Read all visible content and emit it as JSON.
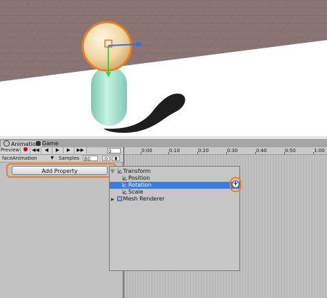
{
  "tabs": [
    {
      "label": "Animation",
      "icon": "animation-clock-icon",
      "active": true
    },
    {
      "label": "Game",
      "icon": "game-controller-icon",
      "active": false
    }
  ],
  "toolbar": {
    "preview_label": "Preview",
    "record_icon": "record-dot-icon",
    "nav_icons": [
      "first-keyframe-icon",
      "prev-keyframe-icon",
      "play-icon",
      "next-keyframe-icon",
      "last-keyframe-icon"
    ],
    "nav_glyphs": [
      "◀◀",
      "◀",
      "▶",
      "▶",
      "▶▶"
    ],
    "frame_value": "0",
    "clip_name": "faceAnimation",
    "samples_label": "Samples",
    "samples_value": "60",
    "add_keyframe_icon": "add-keyframe-icon",
    "add_event_icon": "add-event-icon"
  },
  "add_property": {
    "label": "Add Property"
  },
  "timeline": {
    "ticks": [
      "0:00",
      "0:10",
      "0:20",
      "0:30",
      "0:40",
      "0:50",
      "1:00"
    ]
  },
  "popup": {
    "items": [
      {
        "label": "Transform",
        "icon": "transform-axes-icon",
        "level": 0,
        "expanded": true
      },
      {
        "label": "Position",
        "icon": "transform-axes-icon",
        "level": 1
      },
      {
        "label": "Rotation",
        "icon": "transform-axes-icon",
        "level": 1,
        "selected": true
      },
      {
        "label": "Scale",
        "icon": "transform-axes-icon",
        "level": 1
      },
      {
        "label": "Mesh Renderer",
        "icon": "mesh-renderer-icon",
        "level": 0,
        "expanded": false
      }
    ],
    "plus_glyph": "+"
  },
  "colors": {
    "highlight": "#f07c22",
    "selection": "#3e7bde",
    "ground": "#8a7474",
    "capsule": "#a8e8d0",
    "sphere": "#f3d9a6"
  }
}
